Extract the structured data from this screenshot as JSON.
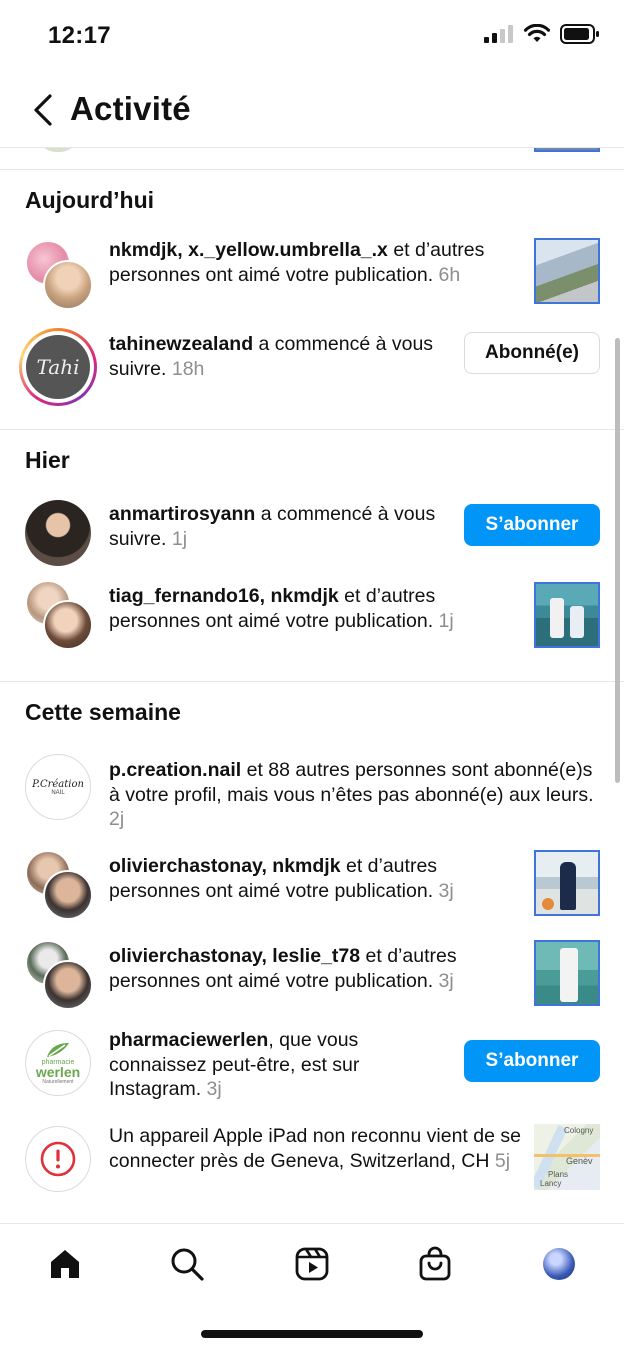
{
  "status_bar": {
    "time": "12:17"
  },
  "header": {
    "title": "Activité"
  },
  "sections": [
    {
      "title": "Aujourd’hui",
      "rows": [
        {
          "user": "nkmdjk, x._yellow.umbrella_.x",
          "text": " et d’autres personnes ont aimé votre publication.",
          "time": "6h"
        },
        {
          "user": "tahinewzealand",
          "text": " a commencé à vous suivre.",
          "time": "18h",
          "button": "Abonné(e)"
        }
      ]
    },
    {
      "title": "Hier",
      "rows": [
        {
          "user": "anmartirosyann",
          "text": " a commencé à vous suivre.",
          "time": "1j",
          "button": "S’abonner"
        },
        {
          "user": "tiag_fernando16, nkmdjk",
          "text": " et d’autres personnes ont aimé votre publication.",
          "time": "1j"
        }
      ]
    },
    {
      "title": "Cette semaine",
      "rows": [
        {
          "user": "p.creation.nail",
          "text": " et 88 autres personnes sont abonné(e)s à votre profil, mais vous n’êtes pas abonné(e) aux leurs.",
          "time": "2j",
          "avatar_text": "P.Création",
          "avatar_sub": "NAIL"
        },
        {
          "user": "olivierchastonay, nkmdjk",
          "text": " et d’autres personnes ont aimé votre publication.",
          "time": "3j"
        },
        {
          "user": "olivierchastonay, leslie_t78",
          "text": " et d’autres personnes ont aimé votre publication.",
          "time": "3j"
        },
        {
          "user": "pharmaciewerlen",
          "text": ", que vous connaissez peut-être, est sur Instagram.",
          "time": "3j",
          "button": "S’abonner",
          "avatar_top": "pharmacie",
          "avatar_brand": "werlen",
          "avatar_sub": "Naturellement"
        },
        {
          "user": "",
          "text": "Un appareil Apple iPad non reconnu vient de se connecter près de Geneva, Switzerland, CH",
          "time": "5j",
          "map_labels": [
            "Cologny",
            "Genèv",
            "Plans",
            "Lancy"
          ]
        }
      ]
    }
  ],
  "tahi_logo": "Tahi",
  "colors": {
    "accent": "#0095f6",
    "thumb_border": "#3f74d8",
    "alert": "#e0303a",
    "muted": "#8e8e8e"
  },
  "nav": {
    "items": [
      "home-icon",
      "search-icon",
      "reels-icon",
      "shop-icon",
      "profile-avatar"
    ]
  }
}
